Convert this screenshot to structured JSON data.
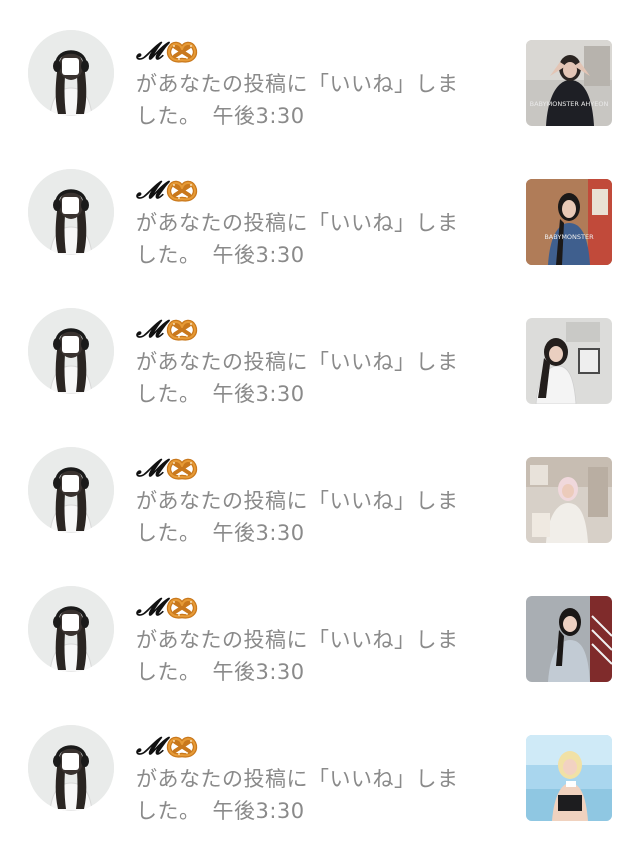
{
  "notifications": [
    {
      "user_name": "𝓜",
      "user_badge_icon": "pretzel-icon",
      "message_line1": "があなたの投稿に「いいね」しま",
      "message_line2": "した。",
      "time": "午後3:30",
      "thumbnail_text": "BABYMONSTER AHYEON"
    },
    {
      "user_name": "𝓜",
      "user_badge_icon": "pretzel-icon",
      "message_line1": "があなたの投稿に「いいね」しま",
      "message_line2": "した。",
      "time": "午後3:30",
      "thumbnail_text": "BABYMONSTER"
    },
    {
      "user_name": "𝓜",
      "user_badge_icon": "pretzel-icon",
      "message_line1": "があなたの投稿に「いいね」しま",
      "message_line2": "した。",
      "time": "午後3:30",
      "thumbnail_text": ""
    },
    {
      "user_name": "𝓜",
      "user_badge_icon": "pretzel-icon",
      "message_line1": "があなたの投稿に「いいね」しま",
      "message_line2": "した。",
      "time": "午後3:30",
      "thumbnail_text": ""
    },
    {
      "user_name": "𝓜",
      "user_badge_icon": "pretzel-icon",
      "message_line1": "があなたの投稿に「いいね」しま",
      "message_line2": "した。",
      "time": "午後3:30",
      "thumbnail_text": ""
    },
    {
      "user_name": "𝓜",
      "user_badge_icon": "pretzel-icon",
      "message_line1": "があなたの投稿に「いいね」しま",
      "message_line2": "した。",
      "time": "午後3:30",
      "thumbnail_text": ""
    }
  ],
  "colors": {
    "message_text": "#8a8a8a",
    "username_text": "#111111",
    "avatar_bg": "#e9ebea"
  }
}
